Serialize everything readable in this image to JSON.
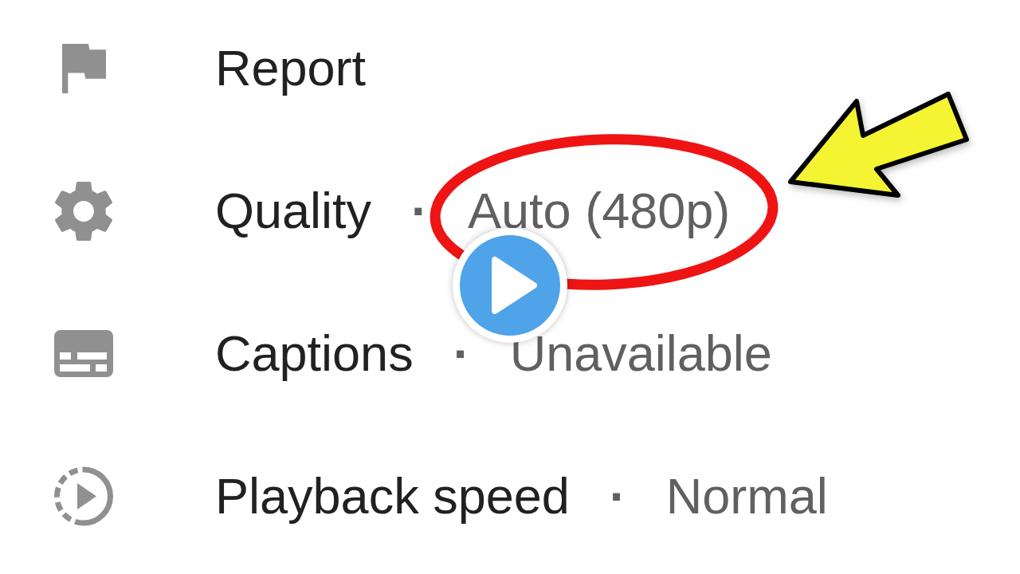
{
  "settings_menu": {
    "items": [
      {
        "label": "Report"
      },
      {
        "label": "Quality",
        "separator": "·",
        "value": "Auto (480p)"
      },
      {
        "label": "Captions",
        "separator": "·",
        "value": "Unavailable"
      },
      {
        "label": "Playback speed",
        "separator": "·",
        "value": "Normal"
      }
    ]
  }
}
